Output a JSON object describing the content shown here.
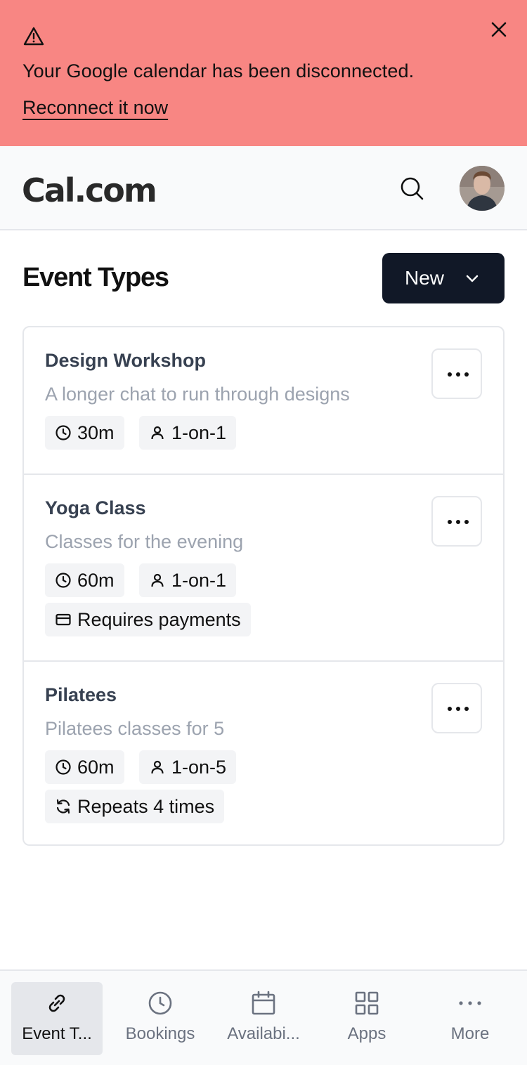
{
  "alert": {
    "message": "Your Google calendar has been disconnected.",
    "link_text": "Reconnect it now",
    "icons": [
      "warning-icon",
      "close-icon"
    ],
    "background_color": "#F88683"
  },
  "header": {
    "logo": "Cal.com",
    "icons": [
      "search-icon"
    ],
    "avatar": "user-avatar"
  },
  "page": {
    "title": "Event Types",
    "new_button_label": "New"
  },
  "events": [
    {
      "title": "Design Workshop",
      "description": "A longer chat to run through designs",
      "duration": "30m",
      "attendees": "1-on-1"
    },
    {
      "title": "Yoga Class",
      "description": "Classes for the evening",
      "duration": "60m",
      "attendees": "1-on-1",
      "extra_badge": "Requires payments"
    },
    {
      "title": "Pilatees",
      "description": "Pilatees classes for 5",
      "duration": "60m",
      "attendees": "1-on-5",
      "extra_badge": "Repeats 4 times"
    }
  ],
  "bottom_nav": {
    "items": [
      {
        "label": "Event T...",
        "icon": "link-icon",
        "active": true
      },
      {
        "label": "Bookings",
        "icon": "clock-icon"
      },
      {
        "label": "Availabi...",
        "icon": "calendar-icon"
      },
      {
        "label": "Apps",
        "icon": "grid-icon"
      },
      {
        "label": "More",
        "icon": "ellipsis-icon"
      }
    ]
  },
  "colors": {
    "primary_button": "#111827",
    "badge_bg": "#F3F4F6",
    "muted_text": "#9CA3AF"
  }
}
